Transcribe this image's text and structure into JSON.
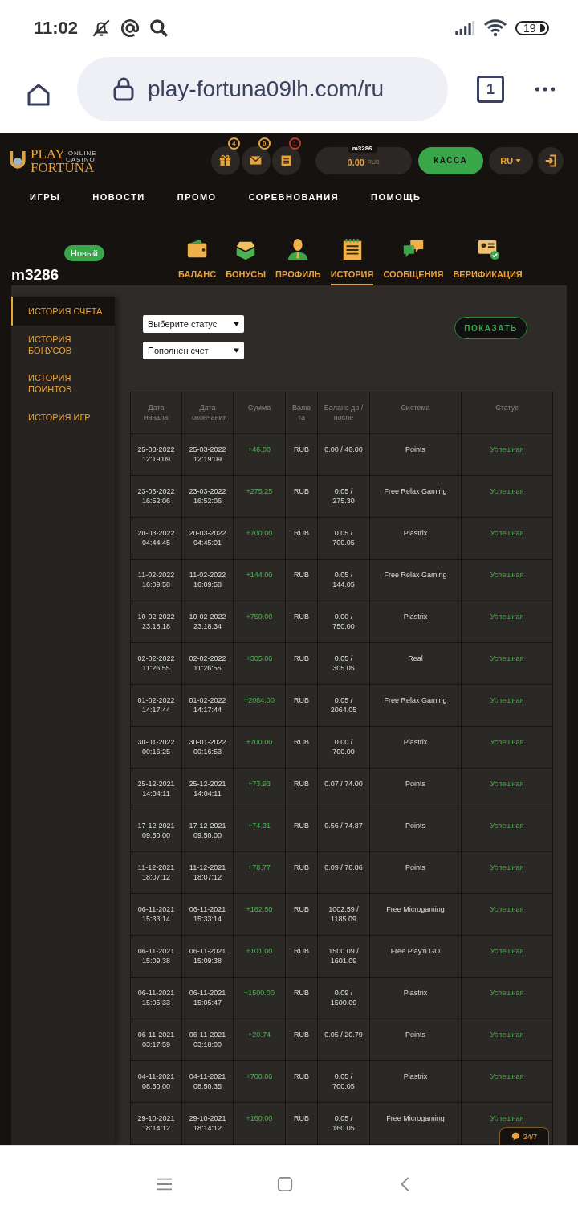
{
  "status_bar": {
    "time": "11:02",
    "battery": "19"
  },
  "browser": {
    "url": "play-fortuna09lh.com/ru",
    "tab_count": "1"
  },
  "header": {
    "logo": {
      "play": "PLAY",
      "fortuna": "FORTUNA",
      "online": "ONLINE",
      "casino": "CASINO"
    },
    "icon_buttons": [
      {
        "badge": "4",
        "color": "#e8a33d"
      },
      {
        "badge": "0",
        "color": "#e8a33d"
      },
      {
        "badge": "1",
        "color": "#c0392b"
      }
    ],
    "balance": {
      "user": "m3286",
      "amount": "0.00",
      "currency": "RUB"
    },
    "cashier_button": "КАССА",
    "language": "RU"
  },
  "nav": [
    "ИГРЫ",
    "НОВОСТИ",
    "ПРОМО",
    "СОРЕВНОВАНИЯ",
    "ПОМОЩЬ"
  ],
  "profile": {
    "username": "m3286",
    "badge": "Новый"
  },
  "tabs": [
    {
      "label": "БАЛАНС",
      "selected": false
    },
    {
      "label": "БОНУСЫ",
      "selected": false
    },
    {
      "label": "ПРОФИЛЬ",
      "selected": false
    },
    {
      "label": "ИСТОРИЯ",
      "selected": true
    },
    {
      "label": "СООБЩЕНИЯ",
      "selected": false
    },
    {
      "label": "ВЕРИФИКАЦИЯ",
      "selected": false
    }
  ],
  "sidebar": {
    "items": [
      {
        "label": "ИСТОРИЯ СЧЕТА",
        "selected": true
      },
      {
        "label": "ИСТОРИЯ БОНУСОВ",
        "selected": false
      },
      {
        "label": "ИСТОРИЯ ПОИНТОВ",
        "selected": false
      },
      {
        "label": "ИСТОРИЯ ИГР",
        "selected": false
      }
    ]
  },
  "filters": {
    "status_select": "Выберите статус",
    "type_select": "Пополнен счет",
    "show_button": "ПОКАЗАТЬ"
  },
  "table": {
    "columns": [
      "Дата начала",
      "Дата окончания",
      "Сумма",
      "Валю та",
      "Баланс до / после",
      "Система",
      "Статус"
    ],
    "rows": [
      [
        "25-03-2022 12:19:09",
        "25-03-2022 12:19:09",
        "+46.00",
        "RUB",
        "0.00 / 46.00",
        "Points",
        "Успешная"
      ],
      [
        "23-03-2022 16:52:06",
        "23-03-2022 16:52:06",
        "+275.25",
        "RUB",
        "0.05 / 275.30",
        "Free Relax Gaming",
        "Успешная"
      ],
      [
        "20-03-2022 04:44:45",
        "20-03-2022 04:45:01",
        "+700.00",
        "RUB",
        "0.05 / 700.05",
        "Piastrix",
        "Успешная"
      ],
      [
        "11-02-2022 16:09:58",
        "11-02-2022 16:09:58",
        "+144.00",
        "RUB",
        "0.05 / 144.05",
        "Free Relax Gaming",
        "Успешная"
      ],
      [
        "10-02-2022 23:18:18",
        "10-02-2022 23:18:34",
        "+750.00",
        "RUB",
        "0.00 / 750.00",
        "Piastrix",
        "Успешная"
      ],
      [
        "02-02-2022 11:26:55",
        "02-02-2022 11:26:55",
        "+305.00",
        "RUB",
        "0.05 / 305.05",
        "Real",
        "Успешная"
      ],
      [
        "01-02-2022 14:17:44",
        "01-02-2022 14:17:44",
        "+2064.00",
        "RUB",
        "0.05 / 2064.05",
        "Free Relax Gaming",
        "Успешная"
      ],
      [
        "30-01-2022 00:16:25",
        "30-01-2022 00:16:53",
        "+700.00",
        "RUB",
        "0.00 / 700.00",
        "Piastrix",
        "Успешная"
      ],
      [
        "25-12-2021 14:04:11",
        "25-12-2021 14:04:11",
        "+73.93",
        "RUB",
        "0.07 / 74.00",
        "Points",
        "Успешная"
      ],
      [
        "17-12-2021 09:50:00",
        "17-12-2021 09:50:00",
        "+74.31",
        "RUB",
        "0.56 / 74.87",
        "Points",
        "Успешная"
      ],
      [
        "11-12-2021 18:07:12",
        "11-12-2021 18:07:12",
        "+78.77",
        "RUB",
        "0.09 / 78.86",
        "Points",
        "Успешная"
      ],
      [
        "06-11-2021 15:33:14",
        "06-11-2021 15:33:14",
        "+182.50",
        "RUB",
        "1002.59 / 1185.09",
        "Free Microgaming",
        "Успешная"
      ],
      [
        "06-11-2021 15:09:38",
        "06-11-2021 15:09:38",
        "+101.00",
        "RUB",
        "1500.09 / 1601.09",
        "Free Play'n GO",
        "Успешная"
      ],
      [
        "06-11-2021 15:05:33",
        "06-11-2021 15:05:47",
        "+1500.00",
        "RUB",
        "0.09 / 1500.09",
        "Piastrix",
        "Успешная"
      ],
      [
        "06-11-2021 03:17:59",
        "06-11-2021 03:18:00",
        "+20.74",
        "RUB",
        "0.05 / 20.79",
        "Points",
        "Успешная"
      ],
      [
        "04-11-2021 08:50:00",
        "04-11-2021 08:50:35",
        "+700.00",
        "RUB",
        "0.05 / 700.05",
        "Piastrix",
        "Успешная"
      ],
      [
        "29-10-2021 18:14:12",
        "29-10-2021 18:14:12",
        "+160.00",
        "RUB",
        "0.05 / 160.05",
        "Free Microgaming",
        "Успешная"
      ]
    ]
  },
  "chat_button": "24/7"
}
